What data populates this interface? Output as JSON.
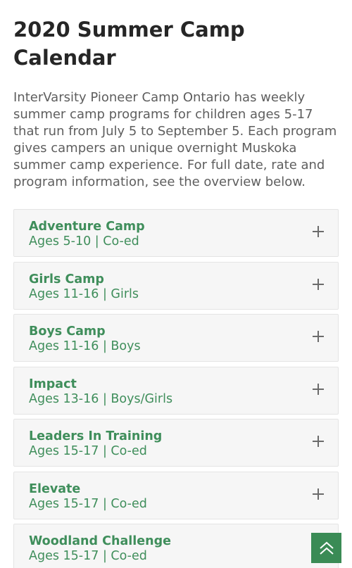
{
  "page": {
    "title": "2020 Summer Camp Calendar",
    "intro": "InterVarsity Pioneer Camp Ontario has weekly summer camp programs for children ages 5-17 that run from July 5 to September 5. Each program gives campers an unique overnight Muskoka summer camp experience. For full date, rate and program information, see the overview below."
  },
  "accordion": {
    "items": [
      {
        "title": "Adventure Camp",
        "subtitle": "Ages 5-10 | Co-ed"
      },
      {
        "title": "Girls Camp",
        "subtitle": "Ages 11-16 | Girls"
      },
      {
        "title": "Boys Camp",
        "subtitle": "Ages 11-16 | Boys"
      },
      {
        "title": "Impact",
        "subtitle": "Ages 13-16 | Boys/Girls"
      },
      {
        "title": "Leaders In Training",
        "subtitle": "Ages 15-17 | Co-ed"
      },
      {
        "title": "Elevate",
        "subtitle": "Ages 15-17 | Co-ed"
      },
      {
        "title": "Woodland Challenge",
        "subtitle": "Ages 15-17 | Co-ed"
      }
    ],
    "expand_icon": "plus-icon"
  },
  "scroll_top": {
    "icon": "double-chevron-up-icon"
  },
  "colors": {
    "accent_green": "#3f8e5b",
    "title_text": "#262626",
    "body_text": "#5e5e5e",
    "panel_bg": "#f6f6f6",
    "scroll_button_bg": "#3a8b55"
  }
}
